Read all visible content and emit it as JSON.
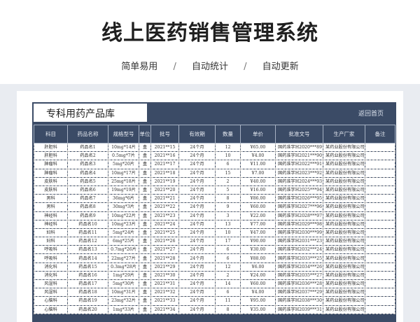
{
  "hero": {
    "title": "线上医药销售管理系统",
    "features": [
      "简单易用",
      "自动统计",
      "自动更新"
    ],
    "separator": "/"
  },
  "sheet": {
    "title": "专科用药产品库",
    "back_label": "返回首页"
  },
  "table": {
    "columns": [
      "科目",
      "药品名称",
      "规格型号",
      "单位",
      "批号",
      "有效期",
      "数量",
      "单价",
      "批准文号",
      "生产厂家",
      "备注"
    ],
    "rows": [
      [
        "肝胆科",
        "药品名1",
        "10mg*14片",
        "盒",
        "2021**15",
        "24个月",
        "12",
        "¥65.00",
        "国药准字H2020***89",
        "某药业股份有限公司",
        ""
      ],
      [
        "肝胆科",
        "药品名2",
        "0.5mg*7片",
        "盒",
        "2021**16",
        "24个月",
        "10",
        "¥4.00",
        "国药准字H2021***90",
        "某药业股份有限公司",
        ""
      ],
      [
        "肿瘤科",
        "药品名3",
        "5mg*20片",
        "盒",
        "2021**17",
        "24个月",
        "6",
        "¥11.00",
        "国药准字H2022***91",
        "某药业股份有限公司",
        ""
      ],
      [
        "肿瘤科",
        "药品名4",
        "10mg*17片",
        "盒",
        "2021**18",
        "24个月",
        "15",
        "¥7.00",
        "国药准字H2023***92",
        "某药业股份有限公司",
        ""
      ],
      [
        "皮肤科",
        "药品名5",
        "25mg*18片",
        "盒",
        "2021**19",
        "24个月",
        "2",
        "¥40.00",
        "国药准字H2024***93",
        "某药业股份有限公司",
        ""
      ],
      [
        "皮肤科",
        "药品名6",
        "19mg*19片",
        "盒",
        "2021**20",
        "24个月",
        "5",
        "¥16.00",
        "国药准字H2025***94",
        "某药业股份有限公司",
        ""
      ],
      [
        "男科",
        "药品名7",
        "36mg*6片",
        "盒",
        "2021**21",
        "24个月",
        "8",
        "¥86.00",
        "国药准字H2026***95",
        "某药业股份有限公司",
        ""
      ],
      [
        "男科",
        "药品名8",
        "30mg*3片",
        "盒",
        "2021**22",
        "24个月",
        "9",
        "¥60.00",
        "国药准字H2027***96",
        "某药业股份有限公司",
        ""
      ],
      [
        "神经科",
        "药品名9",
        "10mg*22片",
        "盒",
        "2021**23",
        "24个月",
        "3",
        "¥22.00",
        "国药准字H2028***97",
        "某药业股份有限公司",
        ""
      ],
      [
        "神经科",
        "药品名10",
        "10mg*23片",
        "盒",
        "2021**24",
        "24个月",
        "13",
        "¥77.00",
        "国药准字H2029***98",
        "某药业股份有限公司",
        ""
      ],
      [
        "妇科",
        "药品名11",
        "5mg*24片",
        "盒",
        "2021**25",
        "24个月",
        "10",
        "¥47.00",
        "国药准字H2030***99",
        "某药业股份有限公司",
        ""
      ],
      [
        "妇科",
        "药品名12",
        "6mg*25片",
        "盒",
        "2021**26",
        "24个月",
        "17",
        "¥90.00",
        "国药准字H2031***23",
        "某药业股份有限公司",
        ""
      ],
      [
        "呼吸科",
        "药品名13",
        "0.7mg*26片",
        "盒",
        "2021**27",
        "24个月",
        "6",
        "¥30.00",
        "国药准字H2032***24",
        "某药业股份有限公司",
        ""
      ],
      [
        "呼吸科",
        "药品名14",
        "22mg*27片",
        "盒",
        "2021**28",
        "24个月",
        "6",
        "¥88.00",
        "国药准字H2033***25",
        "某药业股份有限公司",
        ""
      ],
      [
        "消化科",
        "药品名15",
        "0.3mg*28片",
        "盒",
        "2021**29",
        "24个月",
        "12",
        "¥6.00",
        "国药准字H2034***26",
        "某药业股份有限公司",
        ""
      ],
      [
        "消化科",
        "药品名16",
        "1mg*29片",
        "盒",
        "2021**30",
        "24个月",
        "2",
        "¥24.00",
        "国药准字H2035***27",
        "某药业股份有限公司",
        ""
      ],
      [
        "风湿科",
        "药品名17",
        "5mg*30片",
        "盒",
        "2021**31",
        "24个月",
        "14",
        "¥60.00",
        "国药准字H2036***28",
        "某药业股份有限公司",
        ""
      ],
      [
        "风湿科",
        "药品名18",
        "10mg*31片",
        "盒",
        "2021**32",
        "24个月",
        "6",
        "¥4.00",
        "国药准字H2037***29",
        "某药业股份有限公司",
        ""
      ],
      [
        "心脑科",
        "药品名19",
        "23mg*32片",
        "盒",
        "2021**33",
        "24个月",
        "11",
        "¥95.00",
        "国药准字H2038***30",
        "某药业股份有限公司",
        ""
      ],
      [
        "心脑科",
        "药品名20",
        "1mg*33片",
        "盒",
        "2021**34",
        "24个月",
        "8",
        "¥35.00",
        "国药准字H2039***31",
        "某药业股份有限公司",
        ""
      ]
    ]
  },
  "colors": {
    "header_bg": "#3b4b66",
    "stage_bg": "#e9ecf1"
  }
}
